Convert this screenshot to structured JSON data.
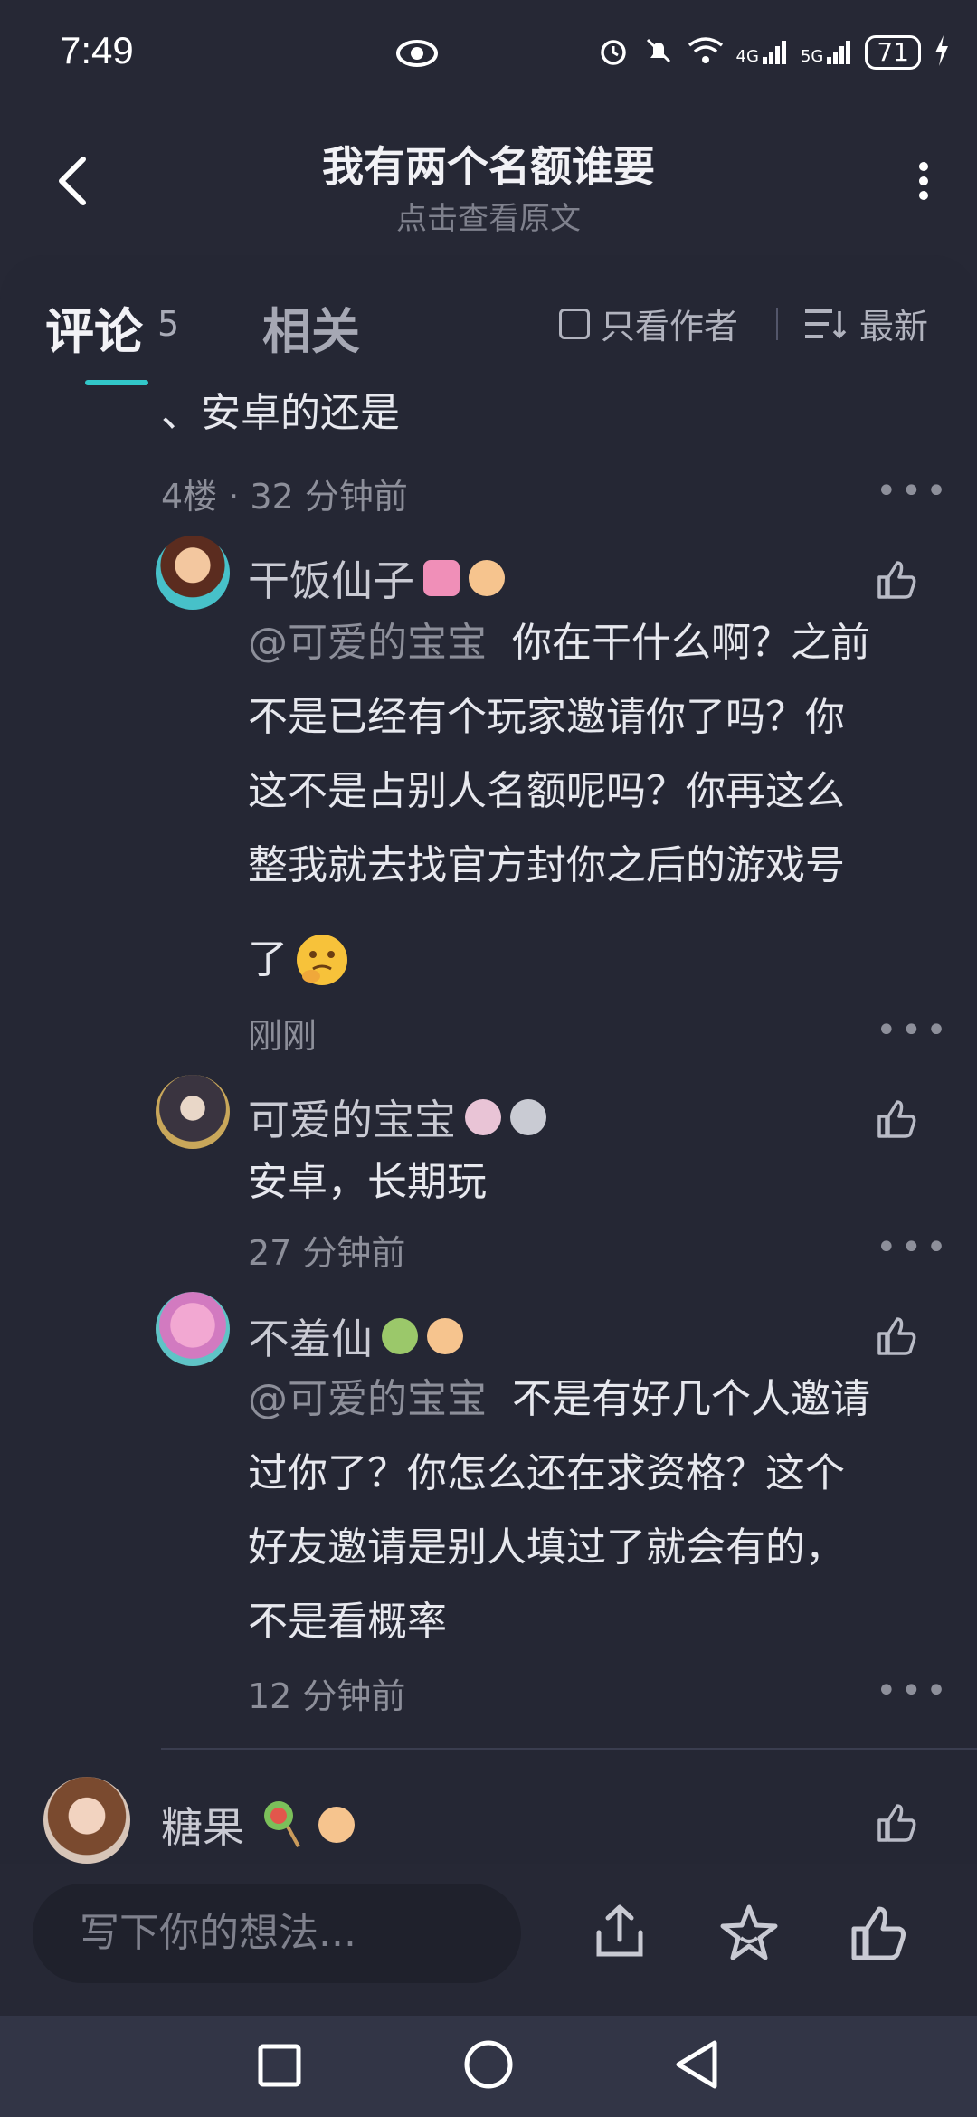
{
  "status_bar": {
    "time": "7:49",
    "battery": "71",
    "network_4g": "4G",
    "network_5g": "5G"
  },
  "header": {
    "title": "我有两个名额谁要",
    "subtitle": "点击查看原文"
  },
  "tabs": {
    "comments_label": "评论",
    "comments_count": "5",
    "related_label": "相关",
    "author_only_label": "只看作者",
    "sort_label": "最新"
  },
  "thread": {
    "top_comment_tail": "、安卓的还是",
    "top_comment_meta": "4楼 · 32 分钟前",
    "replies": [
      {
        "name": "干饭仙子",
        "mention": "@可爱的宝宝",
        "text": "你在干什么啊？之前",
        "lines": [
          "不是已经有个玩家邀请你了吗？你",
          "这不是占别人名额呢吗？你再这么",
          "整我就去找官方封你之后的游戏号",
          "了"
        ],
        "time": "刚刚"
      },
      {
        "name": "可爱的宝宝",
        "text": "安卓，长期玩",
        "time": "27 分钟前"
      },
      {
        "name": "不羞仙",
        "mention": "@可爱的宝宝",
        "text": "不是有好几个人邀请",
        "lines": [
          "过你了？你怎么还在求资格？这个",
          "好友邀请是别人填过了就会有的，",
          "不是看概率"
        ],
        "time": "12 分钟前"
      }
    ]
  },
  "next_comment": {
    "name": "糖果"
  },
  "bottom_bar": {
    "input_placeholder": "写下你的想法..."
  },
  "colors": {
    "background": "#262835",
    "accent": "#32c7c9",
    "navbar": "#323546"
  }
}
